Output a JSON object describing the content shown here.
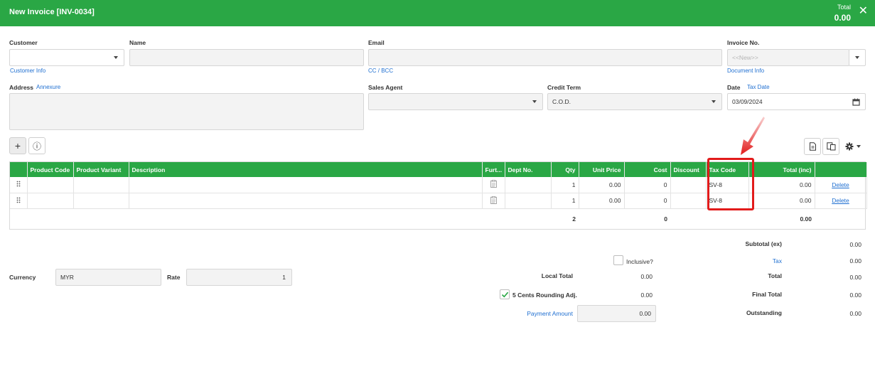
{
  "header": {
    "title": "New Invoice [INV-0034]",
    "total_label": "Total",
    "total_value": "0.00",
    "close_glyph": "✕"
  },
  "form": {
    "customer_label": "Customer",
    "customer_info_link": "Customer Info",
    "name_label": "Name",
    "email_label": "Email",
    "cc_bcc_link": "CC / BCC",
    "invoice_no_label": "Invoice No.",
    "invoice_no_placeholder": "<<New>>",
    "document_info_link": "Document Info",
    "address_label": "Address",
    "annexure_link": "Annexure",
    "sales_agent_label": "Sales Agent",
    "credit_term_label": "Credit Term",
    "credit_term_value": "C.O.D.",
    "date_label": "Date",
    "tax_date_link": "Tax Date",
    "date_value": "03/09/2024"
  },
  "toolbar": {
    "add_glyph": "+",
    "info_glyph": "ⓘ"
  },
  "grid": {
    "columns": [
      "",
      "Product Code",
      "Product Variant",
      "Description",
      "Furt...",
      "Dept No.",
      "Qty",
      "Unit Price",
      "Cost",
      "Discount",
      "Tax Code",
      "Total (inc)",
      ""
    ],
    "rows": [
      {
        "qty": "1",
        "unit_price": "0.00",
        "cost": "0",
        "tax_code": "SV-8",
        "total": "0.00",
        "action": "Delete"
      },
      {
        "qty": "1",
        "unit_price": "0.00",
        "cost": "0",
        "tax_code": "SV-8",
        "total": "0.00",
        "action": "Delete"
      }
    ],
    "footer": {
      "qty_total": "2",
      "cost_total": "0",
      "grand_total": "0.00"
    }
  },
  "bottom": {
    "currency_label": "Currency",
    "currency_value": "MYR",
    "rate_label": "Rate",
    "rate_value": "1",
    "inclusive_label": "Inclusive?",
    "local_total_label": "Local Total",
    "local_total_value": "0.00",
    "rounding_label": "5 Cents Rounding Adj.",
    "rounding_value": "0.00",
    "payment_amount_label": "Payment Amount",
    "payment_amount_value": "0.00"
  },
  "summary": {
    "subtotal_label": "Subtotal (ex)",
    "subtotal_value": "0.00",
    "tax_label": "Tax",
    "tax_value": "0.00",
    "total_label": "Total",
    "total_value": "0.00",
    "final_total_label": "Final Total",
    "final_total_value": "0.00",
    "outstanding_label": "Outstanding",
    "outstanding_value": "0.00"
  },
  "colors": {
    "brand": "#2aa745",
    "link": "#1f6fd1",
    "highlight": "#e21b1b"
  }
}
